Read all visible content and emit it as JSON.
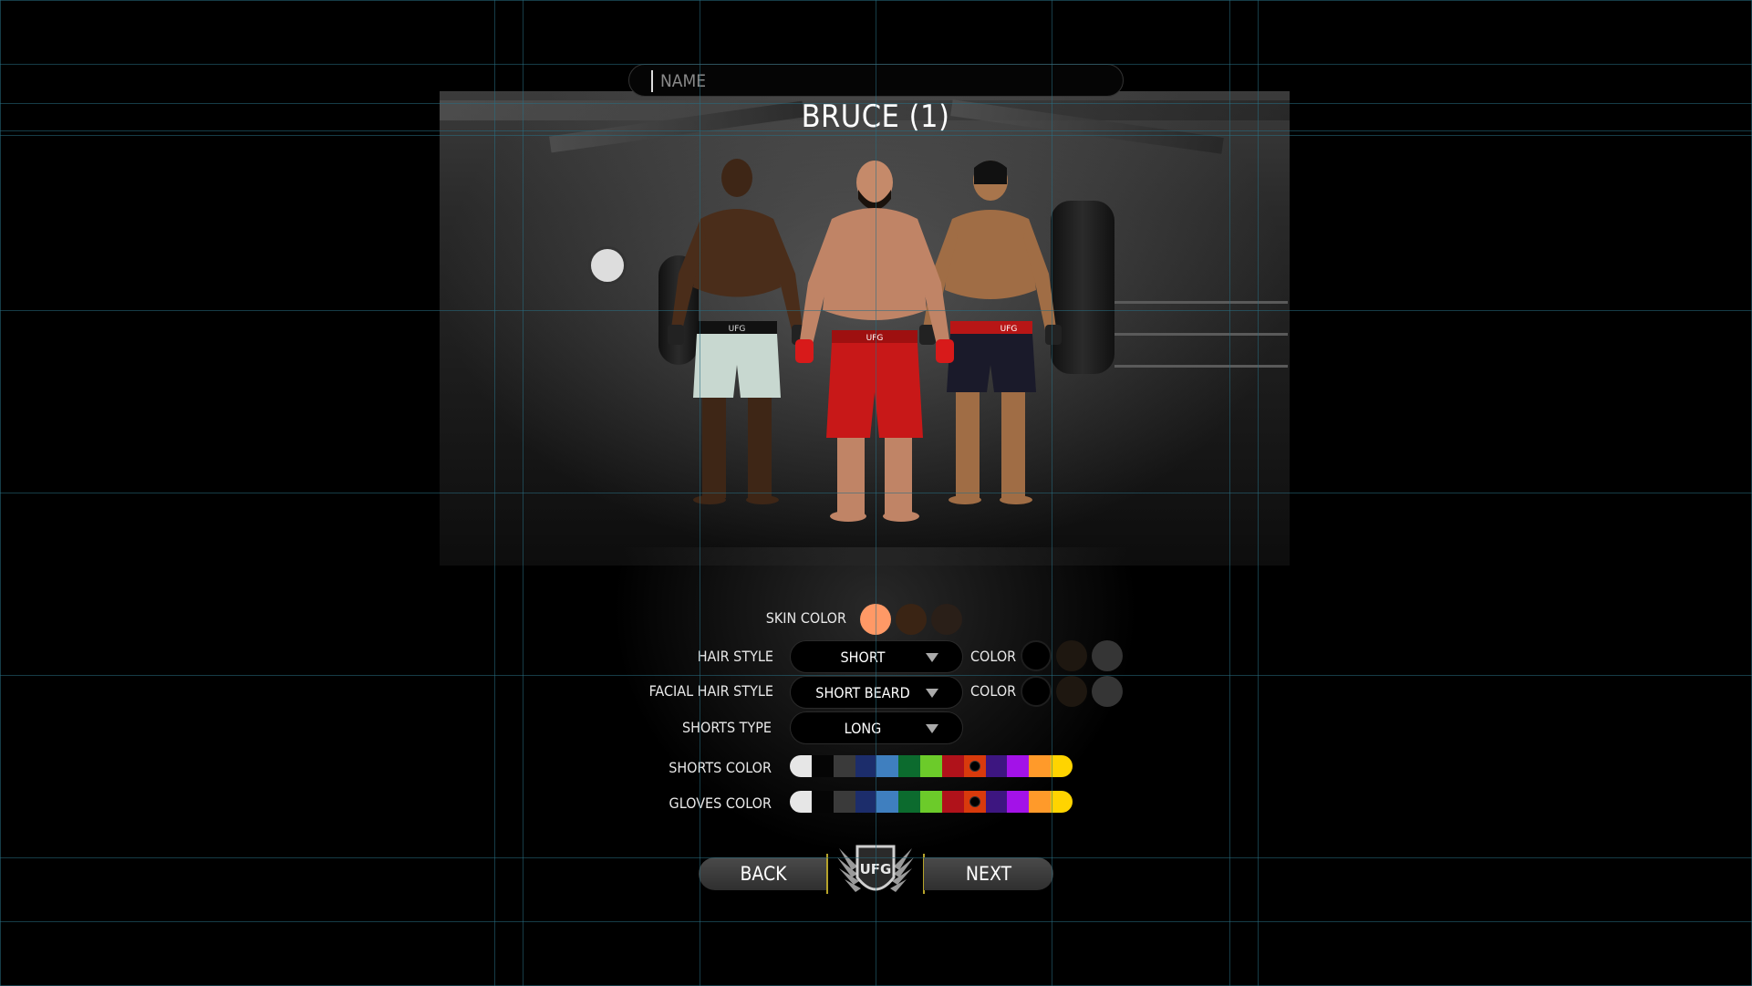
{
  "header": {
    "name_placeholder": "NAME",
    "fighter_title": "BRUCE (1)"
  },
  "form": {
    "skin": {
      "label": "SKIN COLOR",
      "swatches": [
        "#ff9966",
        "#3a2414",
        "#2a1f18"
      ],
      "selected_index": 0
    },
    "hair": {
      "label": "HAIR STYLE",
      "value": "SHORT",
      "color_label": "COLOR",
      "swatches": [
        "#000000",
        "#1e1710",
        "#353535"
      ]
    },
    "facial_hair": {
      "label": "FACIAL HAIR STYLE",
      "value": "SHORT BEARD",
      "color_label": "COLOR",
      "swatches": [
        "#000000",
        "#1e1710",
        "#353535"
      ]
    },
    "shorts_type": {
      "label": "SHORTS TYPE",
      "value": "LONG"
    },
    "shorts_color": {
      "label": "SHORTS COLOR",
      "selected_index": 8
    },
    "gloves_color": {
      "label": "GLOVES COLOR",
      "selected_index": 8
    },
    "palette": [
      "#e6e6e6",
      "#050505",
      "#3a3a3a",
      "#1c2d6b",
      "#3f7fbf",
      "#0c6b2e",
      "#6ccb2a",
      "#b0121a",
      "#d83a0c",
      "#3d1680",
      "#a312e8",
      "#ff9a2a",
      "#ffd400"
    ]
  },
  "nav": {
    "back_label": "BACK",
    "next_label": "NEXT",
    "logo_text": "UFG"
  },
  "fighters": {
    "left_band_text": "UFG",
    "center_band_text": "UFG",
    "right_band_text": "UFG"
  },
  "colors": {
    "accent_gold": "#b6a32a",
    "skin_selected": "#ff9966",
    "center_shorts": "#c81818",
    "left_shorts": "#c8d8d0",
    "right_shorts": "#1a1a2a"
  }
}
